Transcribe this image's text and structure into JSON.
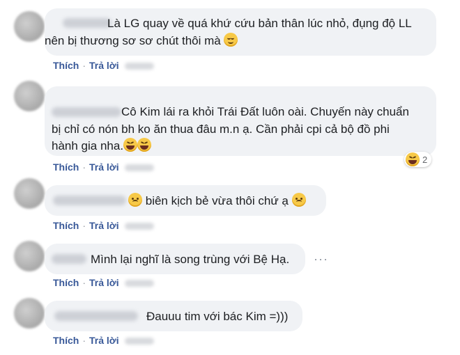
{
  "comments": [
    {
      "lines": [
        "Là LG quay về quá khứ cứu bản thân lúc nhỏ, đụng độ LL",
        "nên bị thương sơ sơ chút thôi mà"
      ],
      "emoji": "relieved-face-emoji",
      "like": "Thích",
      "reply": "Trả lời"
    },
    {
      "lines": [
        "Cô Kim lái ra khỏi Trái Đất luôn oài. Chuyến này chuẩn",
        "bị chỉ có nón bh ko ăn thua đâu m.n ạ. Cần phải cpi cả bộ đồ phi",
        "hành gia nha."
      ],
      "emoji": "rolling-laughing-emoji",
      "reaction_count": "2",
      "like": "Thích",
      "reply": "Trả lời"
    },
    {
      "text": "biên kịch bẻ vừa thôi chứ ạ",
      "emoji": "frowning-face-emoji",
      "like": "Thích",
      "reply": "Trả lời"
    },
    {
      "text": "Mình lại nghĩ là song trùng với Bệ Hạ.",
      "more": "···",
      "like": "Thích",
      "reply": "Trả lời"
    },
    {
      "text": "Đauuu tim với bác Kim =)))",
      "like": "Thích",
      "reply": "Trả lời"
    }
  ],
  "dot": "·"
}
